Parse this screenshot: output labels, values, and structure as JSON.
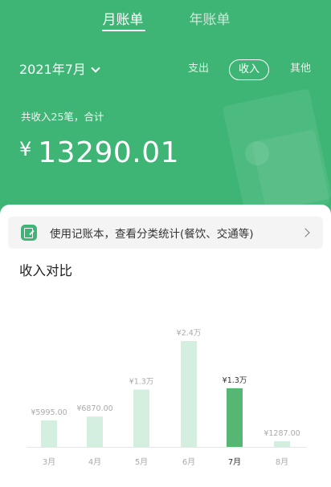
{
  "tabs": {
    "month": "月账单",
    "year": "年账单"
  },
  "month_selector": "2021年7月",
  "type_tabs": {
    "expense": "支出",
    "income": "收入",
    "other": "其他"
  },
  "summary": "共收入25笔，合计",
  "total": {
    "currency": "¥",
    "amount": "13290.01"
  },
  "promo": {
    "text": "使用记账本，查看分类统计(餐饮、交通等)"
  },
  "section_title": "收入对比",
  "colors": {
    "brand_green": "#3eb575",
    "bar_light": "#d4efdf",
    "bar_selected": "#56b775",
    "label_muted": "#aaaaaa"
  },
  "icons": {
    "promo": "notebook-edit-icon",
    "promo_arrow": "chevron-right-icon",
    "month_dropdown": "chevron-down-icon"
  },
  "chart_data": {
    "type": "bar",
    "categories": [
      "3月",
      "4月",
      "5月",
      "6月",
      "7月",
      "8月"
    ],
    "values": [
      5995.0,
      6870.0,
      13000,
      24000,
      13290.01,
      1287.0
    ],
    "labels": [
      "¥5995.00",
      "¥6870.00",
      "¥1.3万",
      "¥2.4万",
      "¥1.3万",
      "¥1287.00"
    ],
    "selected_index": 4,
    "title": "收入对比",
    "xlabel": "",
    "ylabel": "",
    "grid": false
  }
}
